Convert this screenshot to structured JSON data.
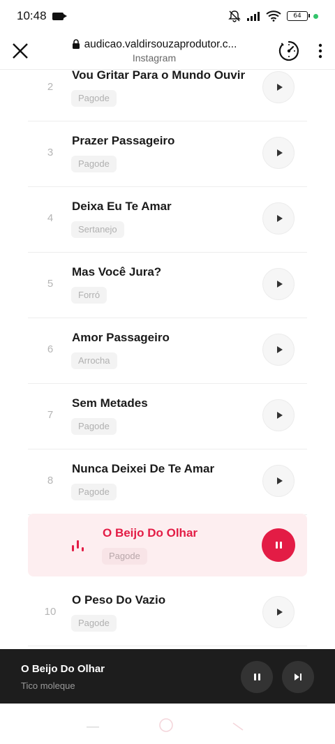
{
  "status": {
    "time": "10:48",
    "battery": "64"
  },
  "browser": {
    "url": "audicao.valdirsouzaprodutor.c...",
    "source": "Instagram"
  },
  "tracks": [
    {
      "number": "2",
      "title": "Vou Gritar Para o Mundo Ouvir",
      "genre": "Pagode"
    },
    {
      "number": "3",
      "title": "Prazer Passageiro",
      "genre": "Pagode"
    },
    {
      "number": "4",
      "title": "Deixa Eu Te Amar",
      "genre": "Sertanejo"
    },
    {
      "number": "5",
      "title": "Mas Você Jura?",
      "genre": "Forró"
    },
    {
      "number": "6",
      "title": "Amor Passageiro",
      "genre": "Arrocha"
    },
    {
      "number": "7",
      "title": "Sem Metades",
      "genre": "Pagode"
    },
    {
      "number": "8",
      "title": "Nunca Deixei De Te Amar",
      "genre": "Pagode"
    },
    {
      "title": "O Beijo Do Olhar",
      "genre": "Pagode",
      "playing": true
    },
    {
      "number": "10",
      "title": "O Peso Do Vazio",
      "genre": "Pagode"
    }
  ],
  "player": {
    "title": "O Beijo Do Olhar",
    "artist": "Tico moleque"
  },
  "colors": {
    "accent": "#e31c45",
    "active_row_bg": "#fdeef0",
    "player_bg": "#1d1d1d"
  },
  "icons": {
    "close": "close-icon",
    "lock": "lock-icon",
    "speed": "speedometer-icon",
    "more": "more-vertical-icon",
    "play": "play-icon",
    "pause": "pause-icon",
    "next": "skip-next-icon",
    "equalizer": "equalizer-icon"
  }
}
